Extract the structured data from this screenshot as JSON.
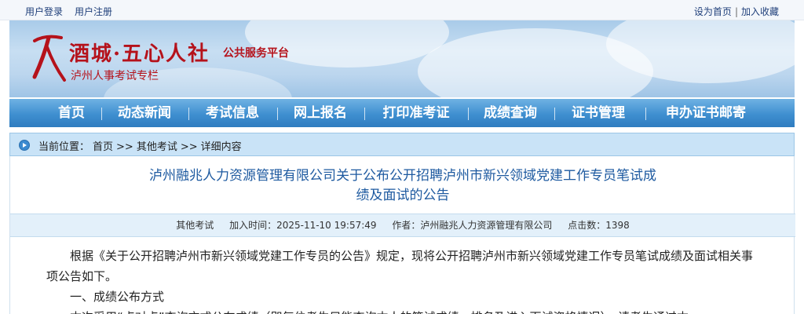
{
  "topbar": {
    "login": "用户登录",
    "register": "用户注册",
    "set_home": "设为首页",
    "separator": "|",
    "add_favorite": "加入收藏"
  },
  "banner": {
    "logo_icon": "jiu-calligraphy-logo-icon",
    "title": "酒城·五心人社",
    "tag": "公共服务平台",
    "subtitle": "泸州人事考试专栏",
    "colors": {
      "brand_red": "#b5121b",
      "sky": "#bcd6ee"
    }
  },
  "nav": {
    "items": [
      "首页",
      "动态新闻",
      "考试信息",
      "网上报名",
      "打印准考证",
      "成绩查询",
      "证书管理",
      "申办证书邮寄"
    ],
    "color": "#3f8fd0"
  },
  "breadcrumb": {
    "icon": "arrow-circle-icon",
    "prefix": "当前位置：",
    "home": "首页",
    "sep": ">>",
    "category": "其他考试",
    "current": "详细内容"
  },
  "article": {
    "title_line1": "泸州融兆人力资源管理有限公司关于公布公开招聘泸州市新兴领域党建工作专员笔试成",
    "title_line2": "绩及面试的公告",
    "meta": {
      "category": "其他考试",
      "time": "加入时间：2025-11-10 19:57:49",
      "author": "作者：泸州融兆人力资源管理有限公司",
      "clicks": "点击数：1398"
    },
    "paragraphs": [
      "根据《关于公开招聘泸州市新兴领域党建工作专员的公告》规定，现将公开招聘泸州市新兴领域党建工作专员笔试成绩及面试相关事项公告如下。",
      "一、成绩公布方式",
      "本次采用“点对点”查询方式公布成绩（即每位考生只能查询本人的笔试成绩、排名及进入面试资格情况）。请考生通过本"
    ]
  }
}
